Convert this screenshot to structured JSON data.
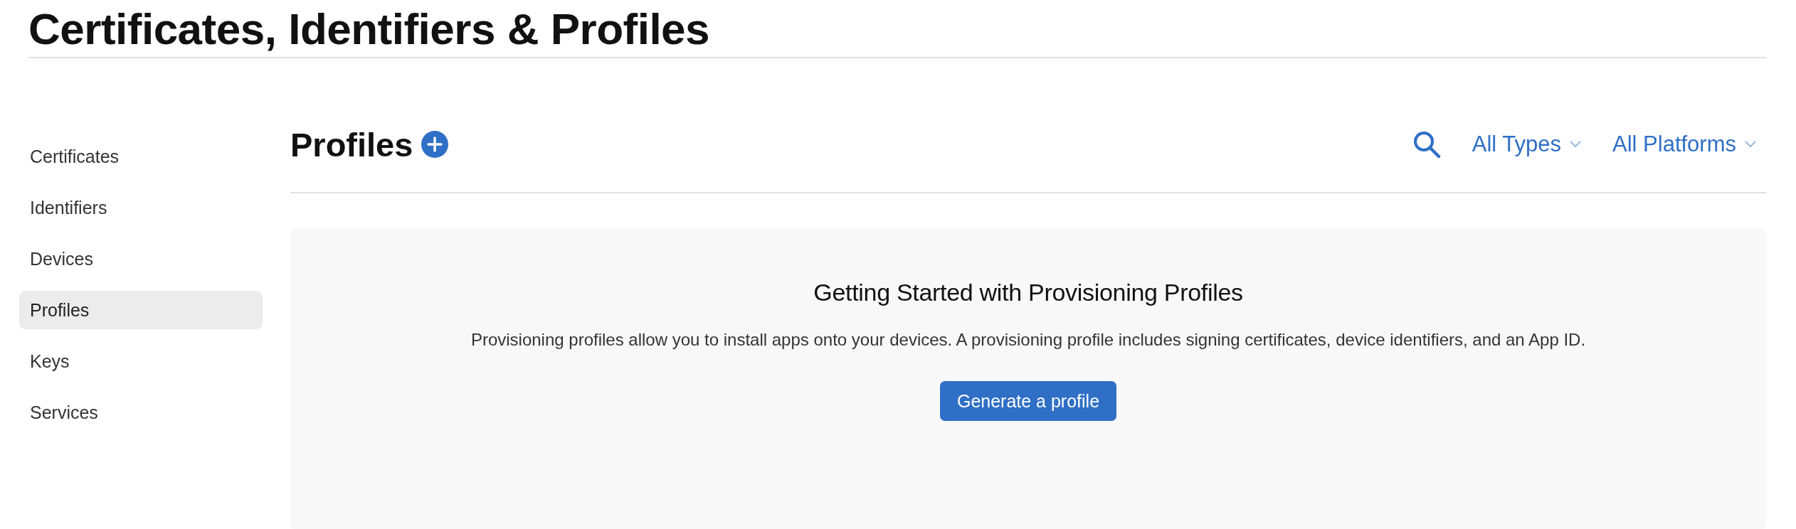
{
  "page_title": "Certificates, Identifiers & Profiles",
  "sidebar": {
    "items": [
      {
        "label": "Certificates",
        "selected": false
      },
      {
        "label": "Identifiers",
        "selected": false
      },
      {
        "label": "Devices",
        "selected": false
      },
      {
        "label": "Profiles",
        "selected": true
      },
      {
        "label": "Keys",
        "selected": false
      },
      {
        "label": "Services",
        "selected": false
      }
    ]
  },
  "section": {
    "title": "Profiles",
    "filters": [
      {
        "label": "All Types"
      },
      {
        "label": "All Platforms"
      }
    ]
  },
  "empty_state": {
    "title": "Getting Started with Provisioning Profiles",
    "description": "Provisioning profiles allow you to install apps onto your devices. A provisioning profile includes signing certificates, device identifiers, and an App ID.",
    "button": "Generate a profile"
  }
}
